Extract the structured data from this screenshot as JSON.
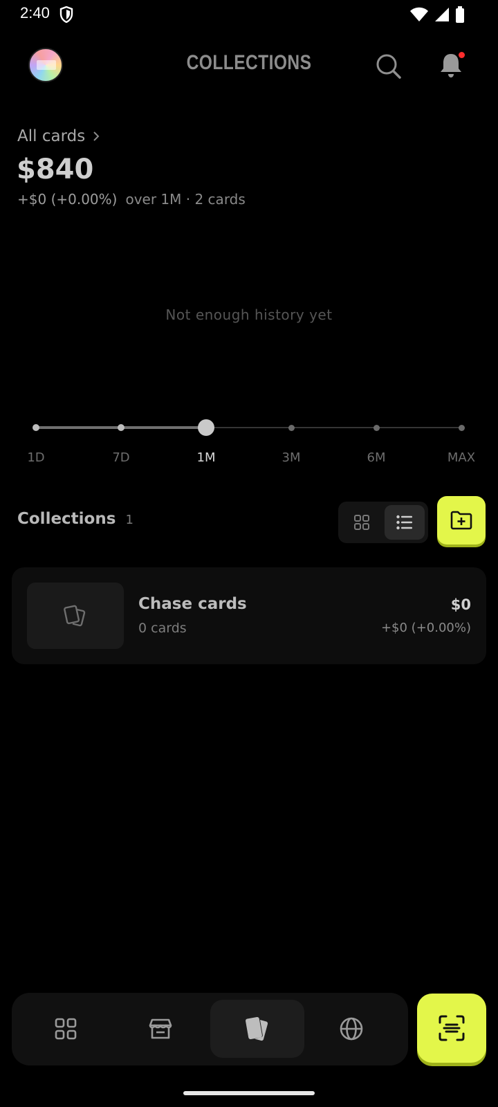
{
  "status_bar": {
    "time": "2:40",
    "icons": [
      "shield-icon",
      "wifi-icon",
      "signal-icon",
      "battery-icon"
    ]
  },
  "header": {
    "title": "COLLECTIONS",
    "icons": [
      "avatar",
      "search-icon",
      "bell-icon"
    ],
    "has_notification": true,
    "notification_dot_color": "#ff2d2d"
  },
  "summary": {
    "all_cards_label": "All cards",
    "total_value": "$840",
    "change": "+$0 (+0.00%)",
    "meta": "over 1M · 2 cards"
  },
  "chart": {
    "empty_message": "Not enough history yet"
  },
  "time_range": {
    "options": [
      "1D",
      "7D",
      "1M",
      "3M",
      "6M",
      "MAX"
    ],
    "selected": "1M"
  },
  "collections": {
    "title": "Collections",
    "count": "1",
    "view_modes": [
      "grid",
      "list"
    ],
    "selected_view": "list",
    "items": [
      {
        "name": "Chase cards",
        "card_count": "0 cards",
        "value": "$0",
        "change": "+$0 (+0.00%)"
      }
    ]
  },
  "bottom_nav": {
    "items": [
      "dashboard-icon",
      "store-icon",
      "cards-icon",
      "globe-icon"
    ],
    "active": "cards-icon",
    "scan_icon": "scan-icon"
  },
  "colors": {
    "accent": "#e3f64a",
    "background": "#000000",
    "surface": "#0d0d0d"
  }
}
